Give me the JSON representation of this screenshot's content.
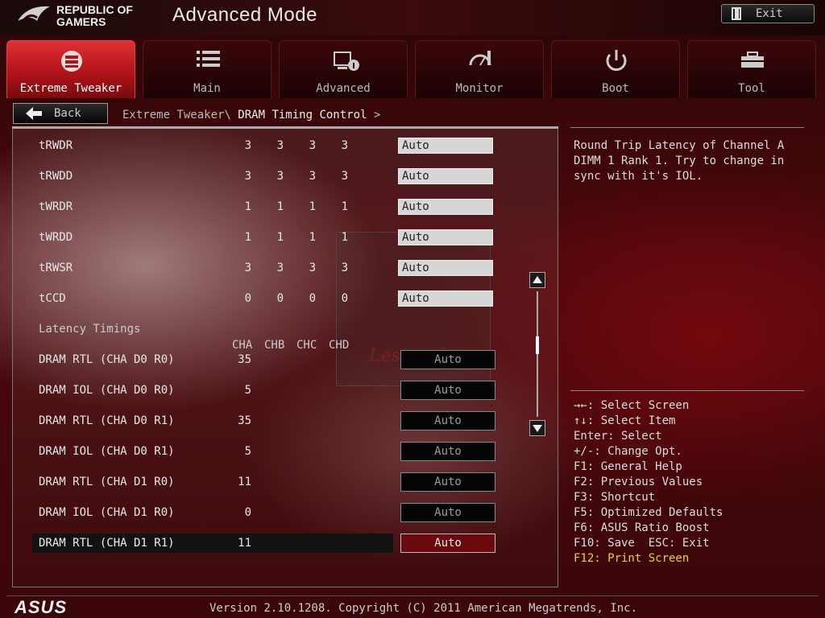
{
  "header": {
    "brand_line1": "REPUBLIC OF",
    "brand_line2": "GAMERS",
    "mode_title": "Advanced Mode",
    "exit_label": "Exit"
  },
  "tabs": [
    {
      "label": "Extreme Tweaker",
      "icon": "tweaker-icon",
      "active": true
    },
    {
      "label": "Main",
      "icon": "list-icon",
      "active": false
    },
    {
      "label": "Advanced",
      "icon": "advanced-icon",
      "active": false
    },
    {
      "label": "Monitor",
      "icon": "monitor-icon",
      "active": false
    },
    {
      "label": "Boot",
      "icon": "power-icon",
      "active": false
    },
    {
      "label": "Tool",
      "icon": "toolbox-icon",
      "active": false
    }
  ],
  "breadcrumb": {
    "back_label": "Back",
    "path_prefix": "Extreme Tweaker\\ ",
    "current": "DRAM Timing Control",
    "suffix": " >"
  },
  "timing_rows": [
    {
      "name": "tRWDR",
      "values": [
        "3",
        "3",
        "3",
        "3"
      ],
      "setting": "Auto"
    },
    {
      "name": "tRWDD",
      "values": [
        "3",
        "3",
        "3",
        "3"
      ],
      "setting": "Auto"
    },
    {
      "name": "tWRDR",
      "values": [
        "1",
        "1",
        "1",
        "1"
      ],
      "setting": "Auto"
    },
    {
      "name": "tWRDD",
      "values": [
        "1",
        "1",
        "1",
        "1"
      ],
      "setting": "Auto"
    },
    {
      "name": "tRWSR",
      "values": [
        "3",
        "3",
        "3",
        "3"
      ],
      "setting": "Auto"
    },
    {
      "name": "tCCD",
      "values": [
        "0",
        "0",
        "0",
        "0"
      ],
      "setting": "Auto"
    }
  ],
  "section_title": "Latency Timings",
  "column_headers": [
    "CHA",
    "CHB",
    "CHC",
    "CHD"
  ],
  "latency_rows": [
    {
      "name": "DRAM RTL (CHA D0 R0)",
      "value": "35",
      "setting": "Auto"
    },
    {
      "name": "DRAM IOL (CHA D0 R0)",
      "value": "5",
      "setting": "Auto"
    },
    {
      "name": "DRAM RTL (CHA D0 R1)",
      "value": "35",
      "setting": "Auto"
    },
    {
      "name": "DRAM IOL (CHA D0 R1)",
      "value": "5",
      "setting": "Auto"
    },
    {
      "name": "DRAM RTL (CHA D1 R0)",
      "value": "11",
      "setting": "Auto"
    },
    {
      "name": "DRAM IOL (CHA D1 R0)",
      "value": "0",
      "setting": "Auto"
    },
    {
      "name": "DRAM RTL (CHA D1 R1)",
      "value": "11",
      "setting": "Auto",
      "selected": true
    }
  ],
  "watermark": "Lesound",
  "help_text": "Round Trip Latency of Channel A DIMM 1 Rank 1. Try to change in sync with it's IOL.",
  "key_help": [
    "→←: Select Screen",
    "↑↓: Select Item",
    "Enter: Select",
    "+/-: Change Opt.",
    "F1: General Help",
    "F2: Previous Values",
    "F3: Shortcut",
    "F5: Optimized Defaults",
    "F6: ASUS Ratio Boost",
    "F10: Save  ESC: Exit",
    "F12: Print Screen"
  ],
  "footer": {
    "brand": "ASUS",
    "version": "Version 2.10.1208. Copyright (C) 2011 American Megatrends, Inc."
  },
  "colors": {
    "accent_red": "#c8181e",
    "selected_red": "#6a0a0e",
    "highlight_yellow": "#f0d020"
  }
}
